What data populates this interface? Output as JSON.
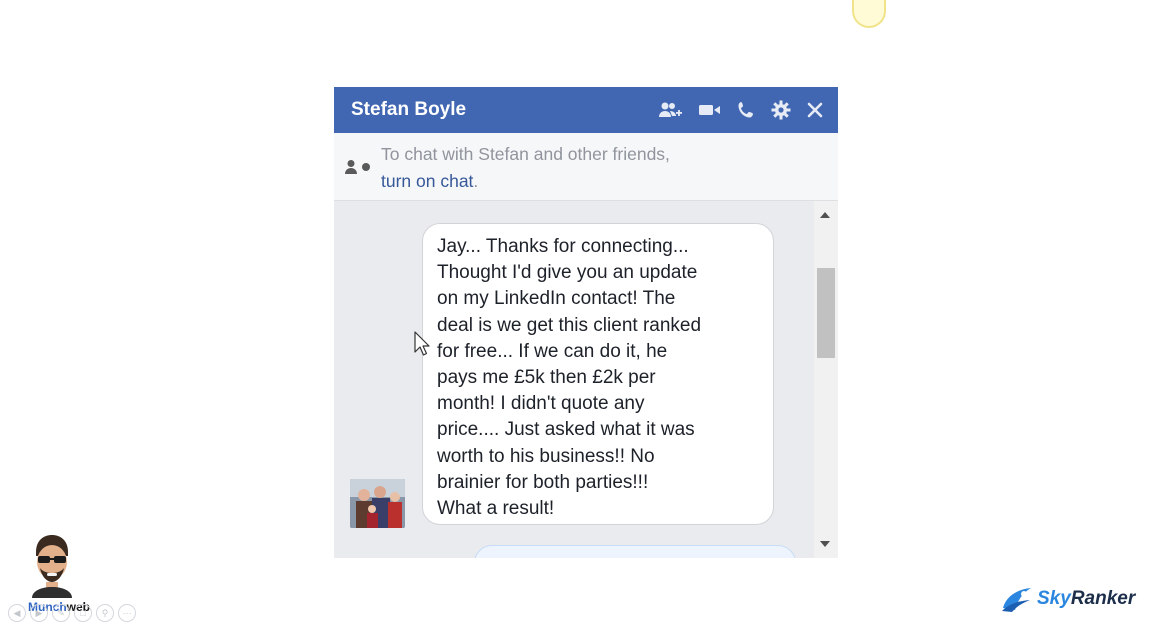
{
  "chat": {
    "contact_name": "Stefan Boyle",
    "header_icons": [
      "add-friend-icon",
      "video-call-icon",
      "voice-call-icon",
      "settings-gear-icon",
      "close-icon"
    ],
    "notice": {
      "text": "To chat with Stefan and other friends,",
      "link": "turn on chat",
      "suffix": "."
    },
    "message": {
      "lines": [
        "Jay... Thanks for connecting...",
        "Thought I'd give you an update",
        "on my LinkedIn contact! The",
        "deal is we get this client ranked",
        "for free... If we can do it, he",
        "pays me £5k then £2k per",
        "month! I didn't quote any",
        "price.... Just asked what it was",
        "worth to his business!! No",
        "brainier for both parties!!!",
        "What a result!"
      ]
    }
  },
  "watermarks": {
    "left_brand_1": "Munch",
    "left_brand_2": "web",
    "right_brand_1": "Sky",
    "right_brand_2": "Ranker"
  },
  "colors": {
    "header": "#4267b2",
    "link": "#365899",
    "chat_background": "#e9ebee"
  }
}
